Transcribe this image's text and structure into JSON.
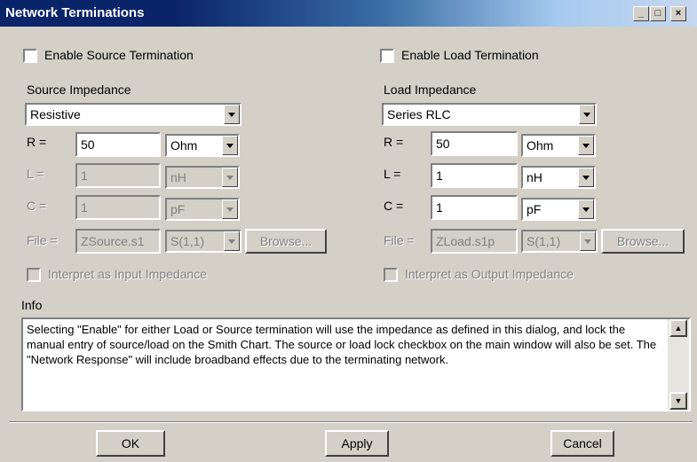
{
  "window": {
    "title": "Network Terminations",
    "minimize": "_",
    "maximize": "□",
    "close": "×"
  },
  "source": {
    "enable_label": "Enable Source Termination",
    "impedance_label": "Source Impedance",
    "type": "Resistive",
    "r_label": "R =",
    "r_value": "50",
    "r_unit": "Ohm",
    "l_label": "L =",
    "l_value": "1",
    "l_unit": "nH",
    "c_label": "C =",
    "c_value": "1",
    "c_unit": "pF",
    "file_label": "File =",
    "file_value": "ZSource.s1",
    "sparam": "S(1,1)",
    "browse": "Browse...",
    "interpret_label": "Interpret as Input Impedance"
  },
  "load": {
    "enable_label": "Enable Load Termination",
    "impedance_label": "Load Impedance",
    "type": "Series RLC",
    "r_label": "R =",
    "r_value": "50",
    "r_unit": "Ohm",
    "l_label": "L =",
    "l_value": "1",
    "l_unit": "nH",
    "c_label": "C =",
    "c_value": "1",
    "c_unit": "pF",
    "file_label": "File =",
    "file_value": "ZLoad.s1p",
    "sparam": "S(1,1)",
    "browse": "Browse...",
    "interpret_label": "Interpret as Output Impedance"
  },
  "info": {
    "label": "Info",
    "text": "Selecting \"Enable\" for either Load or Source termination will use the impedance as defined in this dialog, and lock the manual entry of source/load on the Smith Chart.  The source or load lock checkbox on the main window will also be set. The \"Network Response\" will include broadband effects due to the terminating network."
  },
  "buttons": {
    "ok": "OK",
    "apply": "Apply",
    "cancel": "Cancel"
  }
}
